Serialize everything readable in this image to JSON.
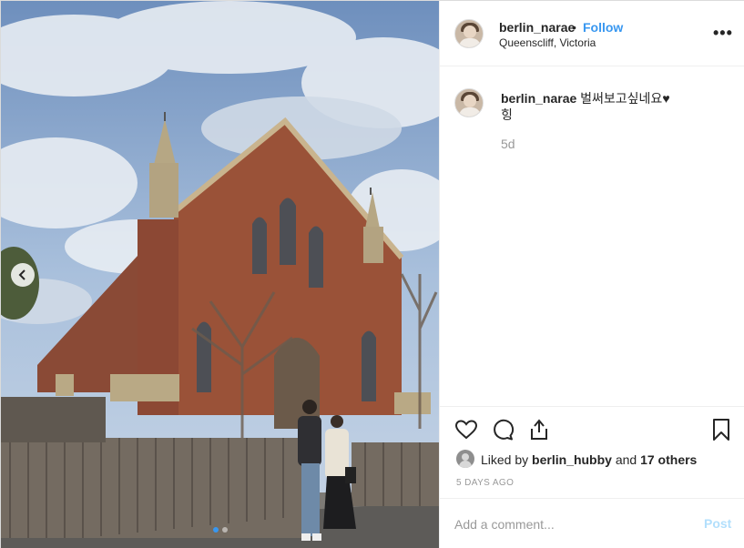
{
  "post": {
    "username": "berlin_narae",
    "separator": "•",
    "follow_label": "Follow",
    "location": "Queenscliff, Victoria",
    "more_label": "•••"
  },
  "caption": {
    "username": "berlin_narae",
    "text": "벌써보고싶네요♥ 힝",
    "time": "5d"
  },
  "likes": {
    "prefix": "Liked by",
    "liker": "berlin_hubby",
    "middle": "and",
    "others": "17 others"
  },
  "timestamp": "5 DAYS AGO",
  "comment_box": {
    "placeholder": "Add a comment...",
    "post_label": "Post"
  },
  "carousel": {
    "total": 2,
    "active_index": 1
  },
  "icons": {
    "prev": "chevron-left-icon",
    "like": "heart-icon",
    "comment": "comment-bubble-icon",
    "share": "share-icon",
    "save": "bookmark-icon",
    "more": "ellipsis-icon"
  },
  "colors": {
    "accent": "#3897f0",
    "post_disabled": "#b2dffc",
    "muted": "#999999"
  }
}
